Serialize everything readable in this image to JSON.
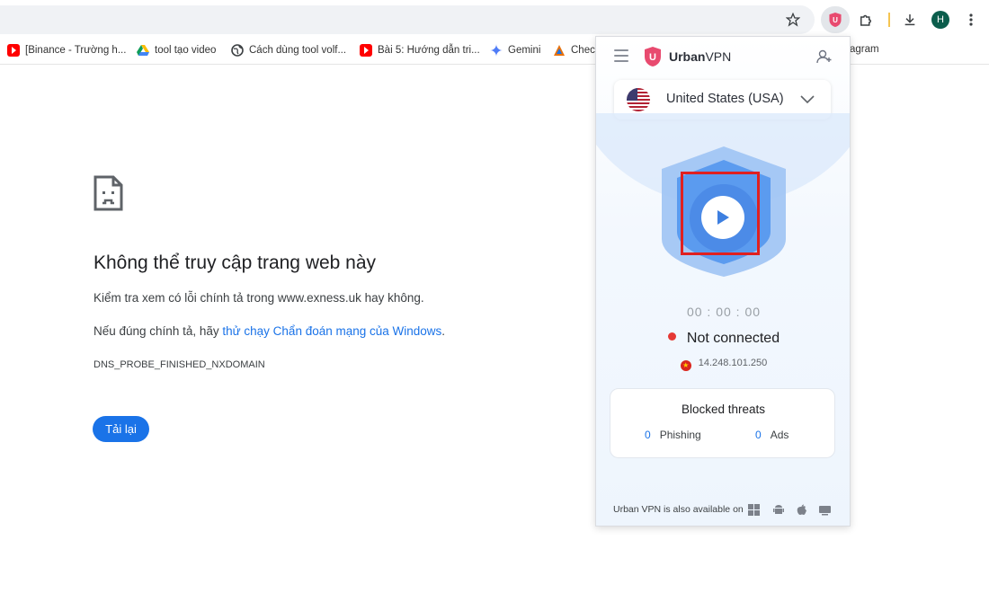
{
  "browser": {
    "profile_initial": "H",
    "bookmarks": [
      {
        "label": "[Binance - Trường h...",
        "icon": "youtube-icon"
      },
      {
        "label": "tool tạo video",
        "icon": "google-drive-icon"
      },
      {
        "label": "Cách dùng tool volf...",
        "icon": "globe-icon"
      },
      {
        "label": "Bài 5: Hướng dẫn tri...",
        "icon": "youtube-icon"
      },
      {
        "label": "Gemini",
        "icon": "gemini-icon"
      },
      {
        "label": "Check",
        "icon": "check-icon"
      },
      {
        "label": "agram",
        "icon": "none"
      }
    ]
  },
  "error_page": {
    "title": "Không thể truy cập trang web này",
    "line1": "Kiểm tra xem có lỗi chính tả trong www.exness.uk hay không.",
    "line2_prefix": "Nếu đúng chính tả, hãy ",
    "line2_link": "thử chạy Chẩn đoán mạng của Windows",
    "line2_suffix": ".",
    "code": "DNS_PROBE_FINISHED_NXDOMAIN",
    "reload_label": "Tải lại"
  },
  "vpn": {
    "brand_bold": "Urban",
    "brand_rest": "VPN",
    "country": "United States (USA)",
    "timer": "00 : 00 : 00",
    "status": "Not connected",
    "ip": "14.248.101.250",
    "threats_title": "Blocked threats",
    "phishing_count": "0",
    "phishing_label": "Phishing",
    "ads_count": "0",
    "ads_label": "Ads",
    "footer": "Urban VPN is also available on",
    "colors": {
      "accent": "#1a73e8",
      "shield": "#5b9bef",
      "highlight": "#e02020",
      "brand": "#e84a6f"
    }
  }
}
